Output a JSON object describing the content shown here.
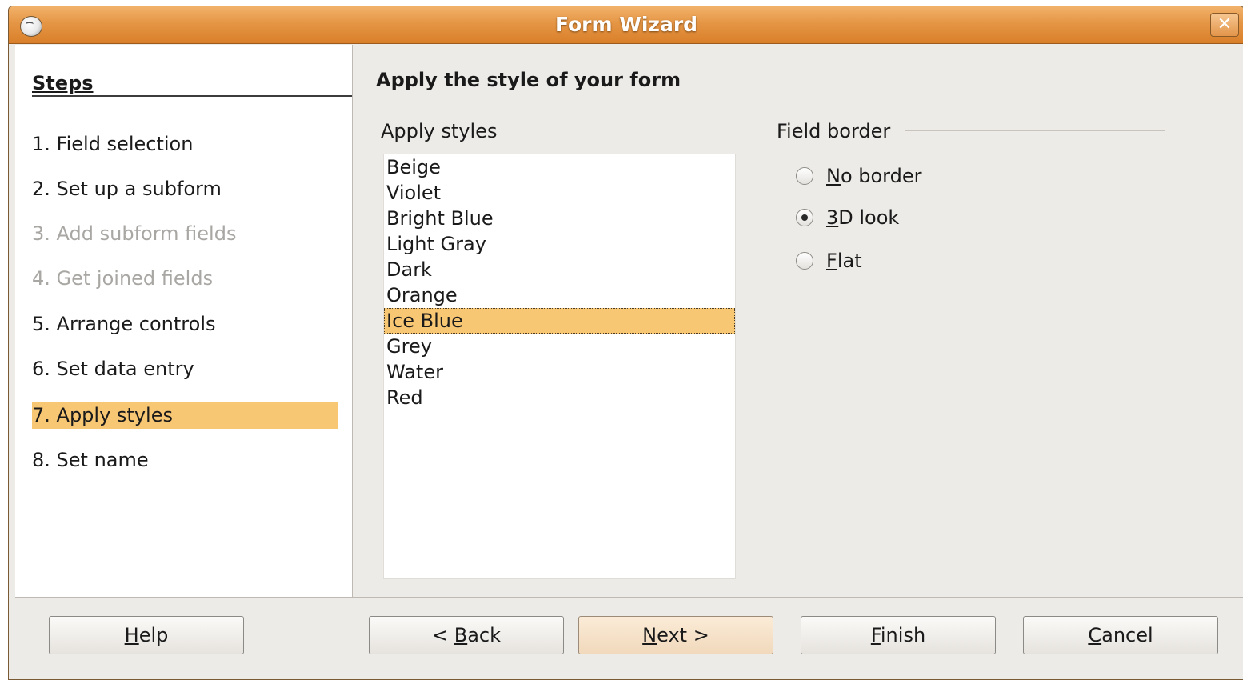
{
  "window": {
    "title": "Form Wizard",
    "close_glyph": "✕"
  },
  "steps": {
    "header": "Steps",
    "items": [
      {
        "label": "1. Field selection",
        "state": "enabled"
      },
      {
        "label": "2. Set up a subform",
        "state": "enabled"
      },
      {
        "label": "3. Add subform fields",
        "state": "disabled"
      },
      {
        "label": "4. Get joined fields",
        "state": "disabled"
      },
      {
        "label": "5. Arrange controls",
        "state": "enabled"
      },
      {
        "label": "6. Set data entry",
        "state": "enabled"
      },
      {
        "label": "7. Apply styles",
        "state": "active"
      },
      {
        "label": "8. Set name",
        "state": "enabled"
      }
    ]
  },
  "main": {
    "heading": "Apply the style of your form",
    "styles_label": "Apply styles",
    "styles": [
      "Beige",
      "Violet",
      "Bright Blue",
      "Light Gray",
      "Dark",
      "Orange",
      "Ice Blue",
      "Grey",
      "Water",
      "Red"
    ],
    "selected_style": "Ice Blue",
    "field_border": {
      "label": "Field border",
      "options": [
        {
          "mnemonic": "N",
          "rest": "o border",
          "checked": false
        },
        {
          "mnemonic": "3",
          "rest": "D look",
          "checked": true
        },
        {
          "mnemonic": "F",
          "rest": "lat",
          "checked": false
        }
      ]
    }
  },
  "buttons": {
    "help": {
      "mnemonic": "H",
      "rest": "elp"
    },
    "back": {
      "pre": "< ",
      "mnemonic": "B",
      "rest": "ack"
    },
    "next": {
      "mnemonic": "N",
      "rest": "ext >"
    },
    "finish": {
      "mnemonic": "F",
      "rest": "inish"
    },
    "cancel": {
      "mnemonic": "C",
      "rest": "ancel"
    }
  },
  "colors": {
    "titlebar_accent": "#e59645",
    "selection": "#f8c774",
    "window_bg": "#edebe7"
  }
}
